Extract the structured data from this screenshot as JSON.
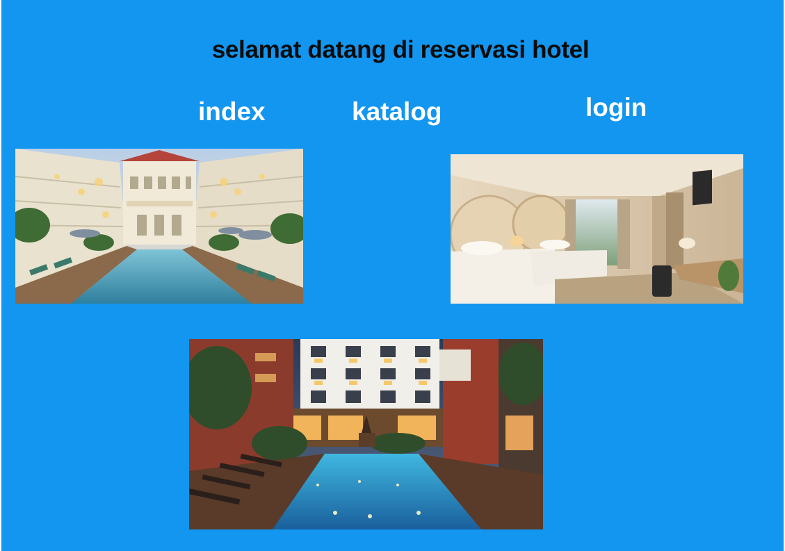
{
  "page": {
    "background": "#1296F0",
    "title": "selamat datang di reservasi hotel"
  },
  "nav": {
    "index": "index",
    "katalog": "katalog",
    "login": "login"
  },
  "images": [
    {
      "name": "hotel-courtyard-pool-photo"
    },
    {
      "name": "hotel-twin-bedroom-photo"
    },
    {
      "name": "hotel-night-pool-photo"
    }
  ]
}
